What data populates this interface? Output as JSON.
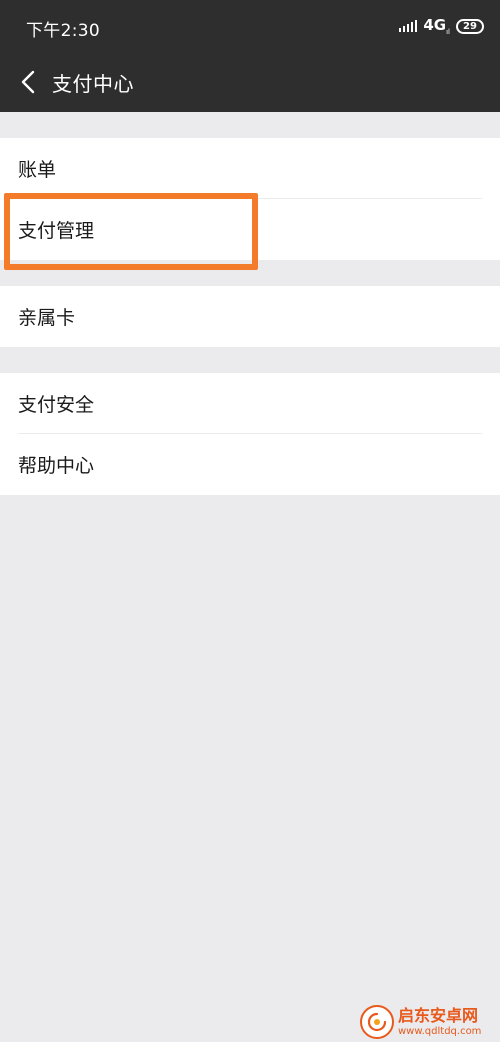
{
  "status_bar": {
    "time": "下午2:30",
    "network": "4G",
    "network_sub": "ıl",
    "battery": "29"
  },
  "nav": {
    "title": "支付中心"
  },
  "groups": [
    {
      "items": [
        {
          "label": "账单"
        },
        {
          "label": "支付管理",
          "highlighted": true
        }
      ]
    },
    {
      "items": [
        {
          "label": "亲属卡"
        }
      ]
    },
    {
      "items": [
        {
          "label": "支付安全"
        },
        {
          "label": "帮助中心"
        }
      ]
    }
  ],
  "watermark": {
    "title": "启东安卓网",
    "url": "www.qdltdq.com"
  },
  "colors": {
    "header": "#2e2e2e",
    "background": "#ebeaed",
    "highlight": "#f47b2a",
    "watermark": "#e8591c"
  }
}
